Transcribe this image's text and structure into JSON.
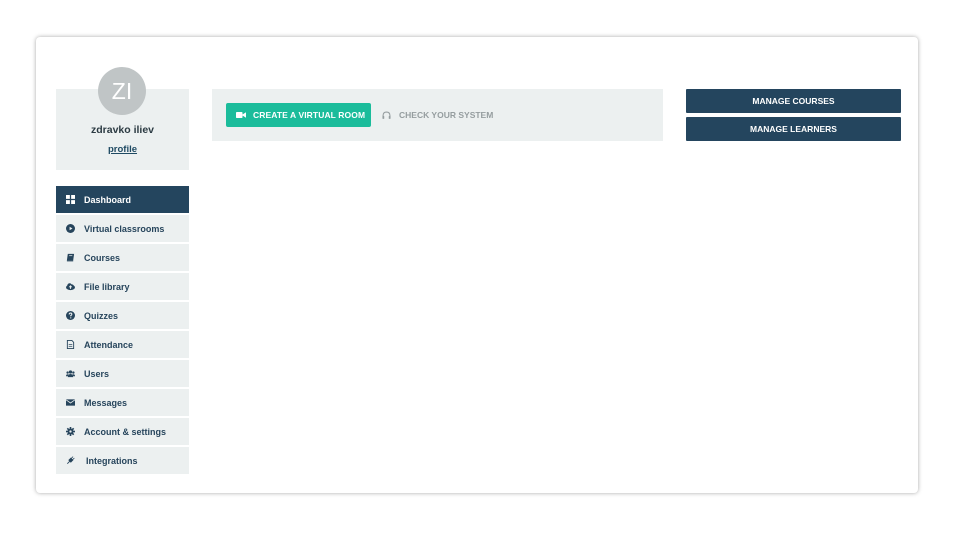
{
  "profile": {
    "initials": "ZI",
    "name": "zdravko iliev",
    "link_label": "profile"
  },
  "sidebar": {
    "items": [
      {
        "label": "Dashboard",
        "icon": "dashboard-icon",
        "active": true
      },
      {
        "label": "Virtual classrooms",
        "icon": "play-circle-icon"
      },
      {
        "label": "Courses",
        "icon": "book-icon"
      },
      {
        "label": "File library",
        "icon": "cloud-upload-icon"
      },
      {
        "label": "Quizzes",
        "icon": "question-circle-icon"
      },
      {
        "label": "Attendance",
        "icon": "document-icon"
      },
      {
        "label": "Users",
        "icon": "users-icon"
      },
      {
        "label": "Messages",
        "icon": "envelope-icon"
      },
      {
        "label": "Account & settings",
        "icon": "gear-icon"
      },
      {
        "label": "Integrations",
        "icon": "plug-icon"
      }
    ]
  },
  "toolbar": {
    "create_label": "CREATE A VIRTUAL ROOM",
    "check_label": "CHECK YOUR SYSTEM"
  },
  "actions": {
    "manage_courses": "MANAGE COURSES",
    "manage_learners": "MANAGE LEARNERS"
  },
  "colors": {
    "primary_dark": "#24455e",
    "accent_green": "#1bbc9b",
    "panel_bg": "#ecf0f0"
  }
}
